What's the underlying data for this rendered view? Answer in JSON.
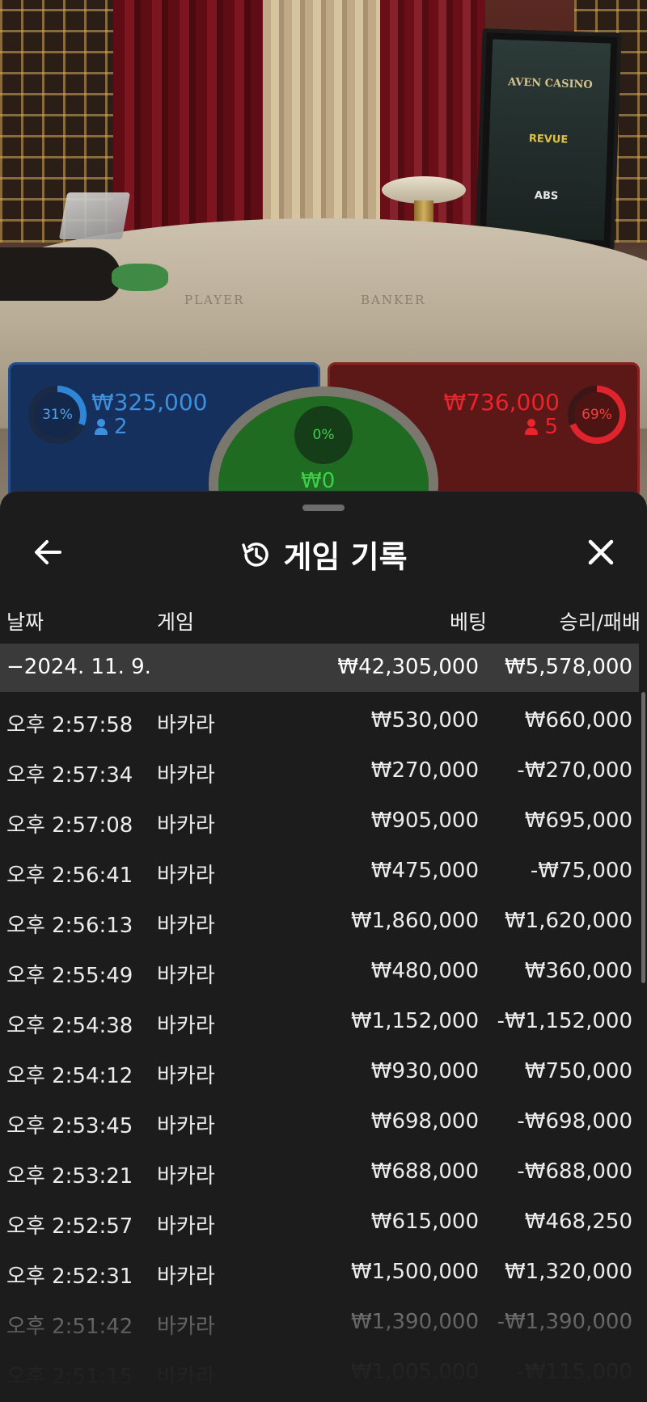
{
  "scene": {
    "felt_player": "PLAYER",
    "felt_banker": "BANKER",
    "monitor_logos": [
      "AVEN CASINO",
      "REVUE",
      "ABS"
    ]
  },
  "bets": {
    "player": {
      "percent": "31%",
      "amount": "₩325,000",
      "players": "2",
      "color": "#3d8fe0"
    },
    "tie": {
      "percent": "0%",
      "amount": "₩0",
      "color": "#3ed04a"
    },
    "banker": {
      "percent": "69%",
      "amount": "₩736,000",
      "players": "5",
      "color": "#e8242c"
    }
  },
  "history": {
    "title": "게임 기록",
    "columns": {
      "date": "날짜",
      "game": "게임",
      "bet": "베팅",
      "win_loss": "승리/패배"
    },
    "day": {
      "date": "−2024. 11. 9.",
      "bet": "₩42,305,000",
      "win_loss": "₩5,578,000"
    },
    "rows": [
      {
        "time": "오후 2:57:58",
        "game": "바카라",
        "bet": "₩530,000",
        "win_loss": "₩660,000"
      },
      {
        "time": "오후 2:57:34",
        "game": "바카라",
        "bet": "₩270,000",
        "win_loss": "-₩270,000"
      },
      {
        "time": "오후 2:57:08",
        "game": "바카라",
        "bet": "₩905,000",
        "win_loss": "₩695,000"
      },
      {
        "time": "오후 2:56:41",
        "game": "바카라",
        "bet": "₩475,000",
        "win_loss": "-₩75,000"
      },
      {
        "time": "오후 2:56:13",
        "game": "바카라",
        "bet": "₩1,860,000",
        "win_loss": "₩1,620,000"
      },
      {
        "time": "오후 2:55:49",
        "game": "바카라",
        "bet": "₩480,000",
        "win_loss": "₩360,000"
      },
      {
        "time": "오후 2:54:38",
        "game": "바카라",
        "bet": "₩1,152,000",
        "win_loss": "-₩1,152,000"
      },
      {
        "time": "오후 2:54:12",
        "game": "바카라",
        "bet": "₩930,000",
        "win_loss": "₩750,000"
      },
      {
        "time": "오후 2:53:45",
        "game": "바카라",
        "bet": "₩698,000",
        "win_loss": "-₩698,000"
      },
      {
        "time": "오후 2:53:21",
        "game": "바카라",
        "bet": "₩688,000",
        "win_loss": "-₩688,000"
      },
      {
        "time": "오후 2:52:57",
        "game": "바카라",
        "bet": "₩615,000",
        "win_loss": "₩468,250"
      },
      {
        "time": "오후 2:52:31",
        "game": "바카라",
        "bet": "₩1,500,000",
        "win_loss": "₩1,320,000"
      },
      {
        "time": "오후 2:51:42",
        "game": "바카라",
        "bet": "₩1,390,000",
        "win_loss": "-₩1,390,000"
      },
      {
        "time": "오후 2:51:15",
        "game": "바카라",
        "bet": "₩1,005,000",
        "win_loss": "-₩115,000"
      }
    ]
  }
}
